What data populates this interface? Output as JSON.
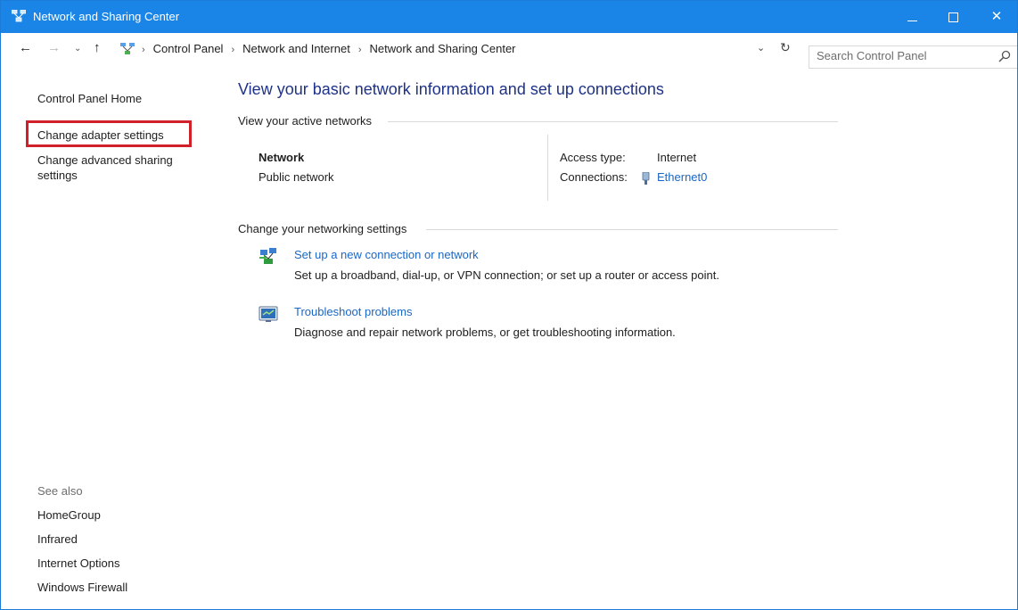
{
  "window": {
    "title": "Network and Sharing Center",
    "controls": {
      "minimize": "minimize",
      "maximize": "maximize",
      "close": "✕"
    }
  },
  "address_bar": {
    "nav": {
      "back": "←",
      "forward": "→",
      "recent": "⌄",
      "up": "↑"
    },
    "breadcrumb": [
      "Control Panel",
      "Network and Internet",
      "Network and Sharing Center"
    ],
    "separator": "›",
    "dropdown": "⌄",
    "refresh": "↻"
  },
  "search": {
    "placeholder": "Search Control Panel"
  },
  "left_pane": {
    "home": "Control Panel Home",
    "adapter": "Change adapter settings",
    "advanced": "Change advanced sharing settings",
    "see_also_header": "See also",
    "see_also": [
      "HomeGroup",
      "Infrared",
      "Internet Options",
      "Windows Firewall"
    ]
  },
  "main": {
    "title": "View your basic network information and set up connections",
    "active_networks_header": "View your active networks",
    "network": {
      "name": "Network",
      "category": "Public network",
      "access_type_label": "Access type:",
      "access_type_value": "Internet",
      "connections_label": "Connections:",
      "connections_value": "Ethernet0"
    },
    "settings_header": "Change your networking settings",
    "tasks": [
      {
        "link": "Set up a new connection or network",
        "desc": "Set up a broadband, dial-up, or VPN connection; or set up a router or access point.",
        "icon": "new-connection-icon"
      },
      {
        "link": "Troubleshoot problems",
        "desc": "Diagnose and repair network problems, or get troubleshooting information.",
        "icon": "troubleshoot-icon"
      }
    ]
  },
  "colors": {
    "title_bar": "#1a85e6",
    "link": "#1a67c6",
    "page_title": "#1e3287",
    "highlight": "#d0202a"
  }
}
